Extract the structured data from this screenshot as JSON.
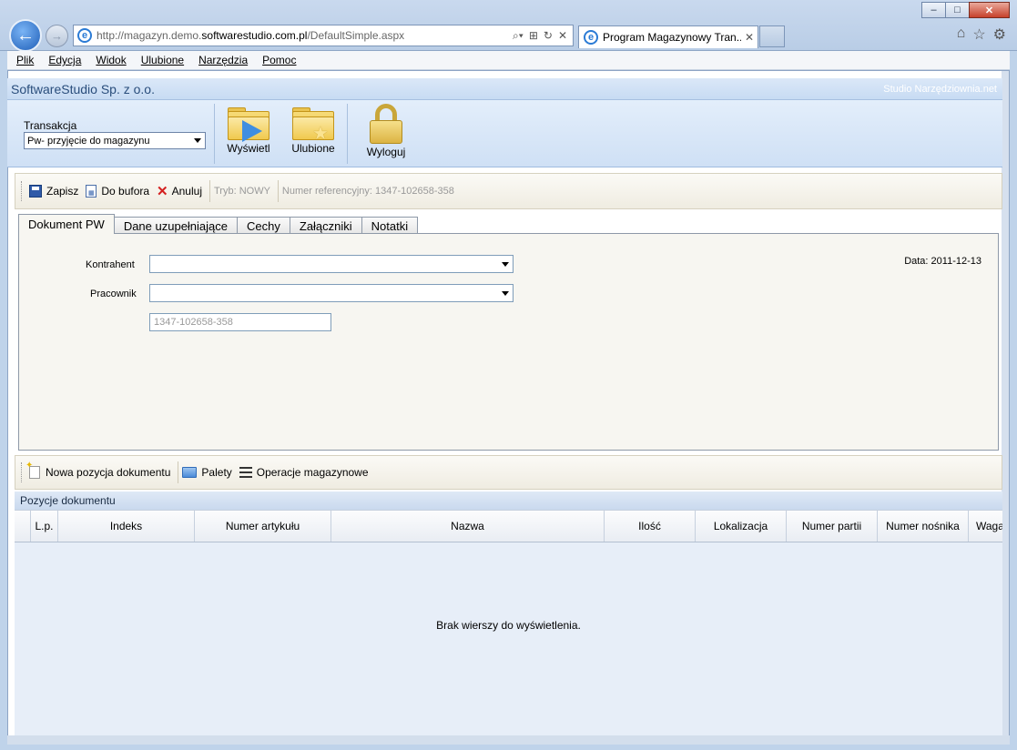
{
  "browser": {
    "url_prefix": "http://magazyn.demo.",
    "url_domain": "softwarestudio.com.pl",
    "url_path": "/DefaultSimple.aspx",
    "tab_title": "Program Magazynowy Tran..."
  },
  "menu": {
    "items": [
      "Plik",
      "Edycja",
      "Widok",
      "Ulubione",
      "Narzędzia",
      "Pomoc"
    ]
  },
  "app": {
    "company": "SoftwareStudio Sp. z o.o.",
    "studio_link": "Studio Narzędziownia.net"
  },
  "ribbon": {
    "transaction_label": "Transakcja",
    "transaction_value": "Pw- przyjęcie do magazynu",
    "show_label": "Wyświetl",
    "favorites_label": "Ulubione",
    "logout_label": "Wyloguj"
  },
  "toolbar": {
    "save_label": "Zapisz",
    "buffer_label": "Do bufora",
    "cancel_label": "Anuluj",
    "mode_text": "Tryb: NOWY",
    "reference_text": "Numer referencyjny: 1347-102658-358"
  },
  "tabs": [
    "Dokument PW",
    "Dane uzupełniające",
    "Cechy",
    "Załączniki",
    "Notatki"
  ],
  "form": {
    "contractor_label": "Kontrahent",
    "employee_label": "Pracownik",
    "reference_value": "1347-102658-358",
    "date_text": "Data: 2011-12-13"
  },
  "toolbar2": {
    "new_item_label": "Nowa pozycja dokumentu",
    "pallets_label": "Palety",
    "operations_label": "Operacje magazynowe"
  },
  "grid": {
    "title": "Pozycje dokumentu",
    "columns": [
      "L.p.",
      "Indeks",
      "Numer artykułu",
      "Nazwa",
      "Ilość",
      "Lokalizacja",
      "Numer partii",
      "Numer nośnika",
      "Waga"
    ],
    "empty_message": "Brak wierszy do wyświetlenia."
  }
}
